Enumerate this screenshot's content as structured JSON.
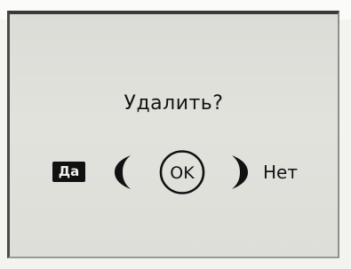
{
  "dialog": {
    "prompt": "Удалить?",
    "yes_label": "Да",
    "ok_label": "OK",
    "no_label": "Нет",
    "icons": {
      "left": "chevron-left-icon",
      "right": "chevron-right-icon"
    }
  }
}
